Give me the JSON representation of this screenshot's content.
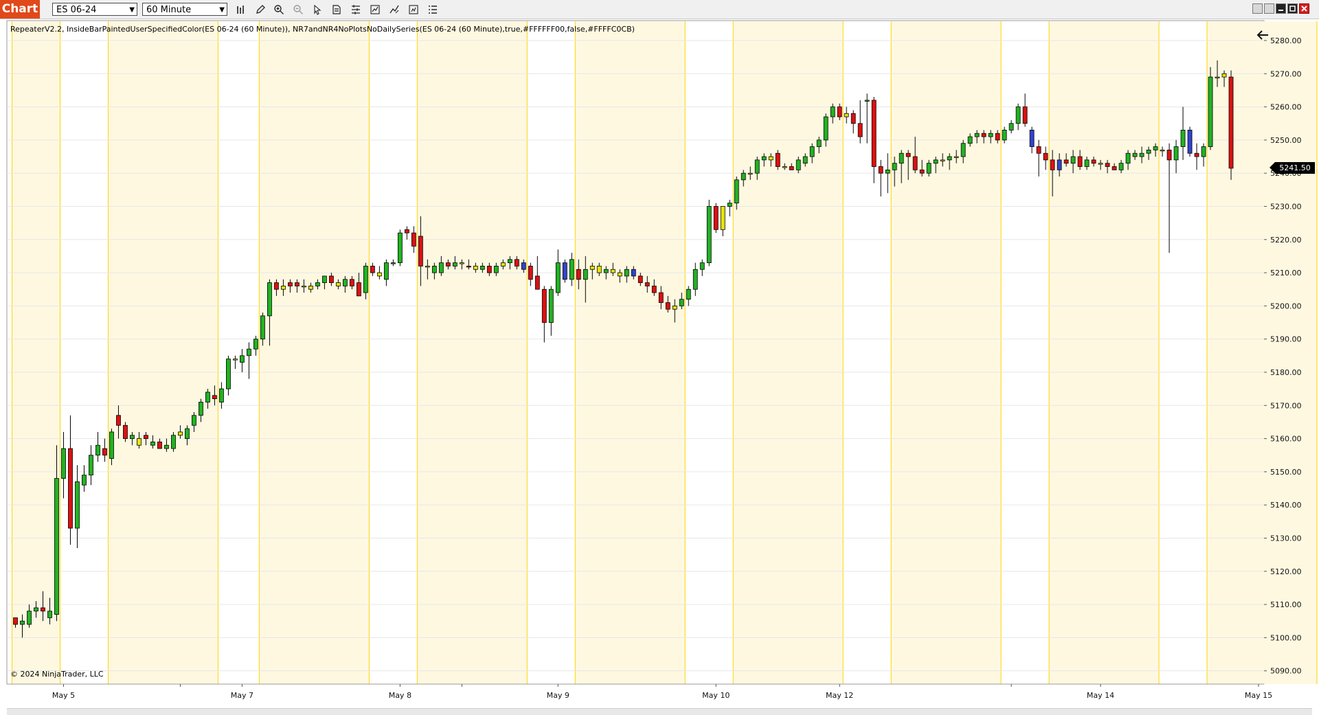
{
  "app": {
    "label": "Chart"
  },
  "toolbar": {
    "instrument": "ES 06-24",
    "interval": "60 Minute"
  },
  "legend_text": "RepeaterV2.2, InsideBarPaintedUserSpecifiedColor(ES 06-24 (60 Minute)), NR7andNR4NoPlotsNoDailySeries(ES 06-24 (60 Minute),true,#FFFFFF00,false,#FFFFC0CB)",
  "copyright": "© 2024 NinjaTrader, LLC",
  "last_price_label": "5241.50",
  "colors": {
    "up": "#22b322",
    "down": "#dd1111",
    "inside_bar": "#e6e600",
    "nr_bar": "#3344cc",
    "band": "#fef8e1",
    "band_line": "#ffd400"
  },
  "chart_data": {
    "type": "candlestick",
    "instrument": "ES 06-24",
    "interval": "60 Minute",
    "ylim": [
      5086,
      5286
    ],
    "y_ticks": [
      "5090.00",
      "5100.00",
      "5110.00",
      "5120.00",
      "5130.00",
      "5140.00",
      "5150.00",
      "5160.00",
      "5170.00",
      "5180.00",
      "5190.00",
      "5200.00",
      "5210.00",
      "5220.00",
      "5230.00",
      "5240.00",
      "5250.00",
      "5260.00",
      "5270.00",
      "5280.00"
    ],
    "x_labels": [
      "May 5",
      "May 7",
      "May 8",
      "May 9",
      "May 10",
      "May 12",
      "May 14",
      "May 15"
    ],
    "last_price": 5241.5,
    "session_bands": [
      [
        0,
        6
      ],
      [
        14,
        29
      ],
      [
        36,
        51
      ],
      [
        59,
        74
      ],
      [
        82,
        97
      ],
      [
        105,
        120
      ],
      [
        128,
        143
      ],
      [
        151,
        166
      ],
      [
        174,
        189
      ]
    ],
    "candles": [
      [
        5106,
        5106,
        5103,
        5104,
        "d"
      ],
      [
        5104,
        5107,
        5100,
        5105,
        "u"
      ],
      [
        5104,
        5110,
        5103,
        5108,
        "u"
      ],
      [
        5108,
        5111,
        5106,
        5109,
        "u"
      ],
      [
        5109,
        5114,
        5105,
        5108,
        "d"
      ],
      [
        5106,
        5112,
        5104,
        5108,
        "u"
      ],
      [
        5107,
        5158,
        5105,
        5148,
        "u"
      ],
      [
        5148,
        5162,
        5142,
        5157,
        "u"
      ],
      [
        5157,
        5167,
        5128,
        5133,
        "d"
      ],
      [
        5133,
        5152,
        5127,
        5147,
        "u"
      ],
      [
        5146,
        5152,
        5144,
        5149,
        "u"
      ],
      [
        5149,
        5158,
        5146,
        5155,
        "u"
      ],
      [
        5155,
        5162,
        5153,
        5158,
        "u"
      ],
      [
        5155,
        5160,
        5153,
        5157,
        "d"
      ],
      [
        5154,
        5163,
        5152,
        5162,
        "u"
      ],
      [
        5164,
        5170,
        5160,
        5167,
        "d"
      ],
      [
        5164,
        5165,
        5159,
        5160,
        "d"
      ],
      [
        5160,
        5162,
        5158,
        5161,
        "u"
      ],
      [
        5158,
        5162,
        5157,
        5160,
        "i"
      ],
      [
        5161,
        5162,
        5158,
        5160,
        "d"
      ],
      [
        5158,
        5161,
        5157,
        5159,
        "u"
      ],
      [
        5159,
        5160,
        5157,
        5157,
        "d"
      ],
      [
        5157,
        5160,
        5156,
        5158,
        "u"
      ],
      [
        5157,
        5162,
        5156,
        5161,
        "u"
      ],
      [
        5162,
        5164,
        5160,
        5161,
        "i"
      ],
      [
        5160,
        5164,
        5158,
        5163,
        "u"
      ],
      [
        5164,
        5168,
        5162,
        5167,
        "u"
      ],
      [
        5167,
        5172,
        5165,
        5171,
        "u"
      ],
      [
        5171,
        5175,
        5169,
        5174,
        "u"
      ],
      [
        5173,
        5176,
        5170,
        5172,
        "d"
      ],
      [
        5171,
        5177,
        5169,
        5175,
        "u"
      ],
      [
        5175,
        5185,
        5173,
        5184,
        "u"
      ],
      [
        5184,
        5185,
        5181,
        5184,
        "i"
      ],
      [
        5183,
        5187,
        5180,
        5185,
        "u"
      ],
      [
        5185,
        5189,
        5178,
        5187,
        "u"
      ],
      [
        5187,
        5191,
        5185,
        5190,
        "u"
      ],
      [
        5190,
        5198,
        5188,
        5197,
        "u"
      ],
      [
        5197,
        5208,
        5188,
        5207,
        "u"
      ],
      [
        5207,
        5208,
        5203,
        5205,
        "d"
      ],
      [
        5205,
        5208,
        5203,
        5206,
        "i"
      ],
      [
        5206,
        5208,
        5204,
        5207,
        "d"
      ],
      [
        5207,
        5208,
        5204,
        5206,
        "d"
      ],
      [
        5206,
        5208,
        5204,
        5206,
        "i"
      ],
      [
        5206,
        5207,
        5204,
        5205,
        "i"
      ],
      [
        5206,
        5208,
        5205,
        5207,
        "u"
      ],
      [
        5207,
        5209,
        5205,
        5209,
        "u"
      ],
      [
        5209,
        5210,
        5206,
        5207,
        "d"
      ],
      [
        5207,
        5208,
        5205,
        5206,
        "i"
      ],
      [
        5206,
        5209,
        5204,
        5208,
        "u"
      ],
      [
        5208,
        5209,
        5205,
        5206,
        "d"
      ],
      [
        5207,
        5210,
        5203,
        5203,
        "d"
      ],
      [
        5204,
        5213,
        5202,
        5212,
        "u"
      ],
      [
        5212,
        5213,
        5209,
        5210,
        "d"
      ],
      [
        5209,
        5212,
        5208,
        5210,
        "i"
      ],
      [
        5208,
        5214,
        5206,
        5213,
        "u"
      ],
      [
        5213,
        5214,
        5212,
        5213,
        "u"
      ],
      [
        5213,
        5223,
        5212,
        5222,
        "u"
      ],
      [
        5222,
        5224,
        5220,
        5223,
        "d"
      ],
      [
        5222,
        5224,
        5216,
        5218,
        "d"
      ],
      [
        5221,
        5227,
        5206,
        5212,
        "d"
      ],
      [
        5212,
        5214,
        5208,
        5212,
        "i"
      ],
      [
        5212,
        5213,
        5208,
        5210,
        "u"
      ],
      [
        5210,
        5215,
        5209,
        5213,
        "u"
      ],
      [
        5213,
        5214,
        5211,
        5212,
        "d"
      ],
      [
        5212,
        5215,
        5211,
        5213,
        "u"
      ],
      [
        5213,
        5214,
        5211,
        5213,
        "i"
      ],
      [
        5212,
        5214,
        5211,
        5212,
        "d"
      ],
      [
        5212,
        5213,
        5210,
        5211,
        "i"
      ],
      [
        5211,
        5213,
        5210,
        5212,
        "u"
      ],
      [
        5212,
        5213,
        5209,
        5210,
        "d"
      ],
      [
        5210,
        5213,
        5209,
        5212,
        "u"
      ],
      [
        5212,
        5214,
        5211,
        5213,
        "i"
      ],
      [
        5213,
        5215,
        5211,
        5214,
        "u"
      ],
      [
        5214,
        5215,
        5211,
        5212,
        "d"
      ],
      [
        5213,
        5214,
        5210,
        5211,
        "b"
      ],
      [
        5212,
        5213,
        5206,
        5208,
        "d"
      ],
      [
        5209,
        5215,
        5206,
        5205,
        "d"
      ],
      [
        5205,
        5206,
        5189,
        5195,
        "d"
      ],
      [
        5195,
        5206,
        5191,
        5205,
        "u"
      ],
      [
        5204,
        5217,
        5203,
        5213,
        "u"
      ],
      [
        5213,
        5214,
        5207,
        5208,
        "b"
      ],
      [
        5208,
        5216,
        5206,
        5214,
        "u"
      ],
      [
        5211,
        5214,
        5205,
        5208,
        "d"
      ],
      [
        5208,
        5215,
        5201,
        5211,
        "u"
      ],
      [
        5211,
        5213,
        5208,
        5212,
        "i"
      ],
      [
        5212,
        5213,
        5209,
        5210,
        "i"
      ],
      [
        5210,
        5212,
        5208,
        5211,
        "u"
      ],
      [
        5211,
        5213,
        5209,
        5210,
        "i"
      ],
      [
        5210,
        5211,
        5207,
        5209,
        "i"
      ],
      [
        5209,
        5212,
        5207,
        5211,
        "u"
      ],
      [
        5211,
        5212,
        5208,
        5209,
        "b"
      ],
      [
        5209,
        5210,
        5206,
        5207,
        "d"
      ],
      [
        5207,
        5209,
        5204,
        5206,
        "d"
      ],
      [
        5206,
        5208,
        5203,
        5204,
        "d"
      ],
      [
        5204,
        5206,
        5199,
        5201,
        "d"
      ],
      [
        5201,
        5203,
        5198,
        5199,
        "d"
      ],
      [
        5199,
        5202,
        5195,
        5200,
        "i"
      ],
      [
        5200,
        5204,
        5199,
        5202,
        "u"
      ],
      [
        5202,
        5206,
        5200,
        5205,
        "u"
      ],
      [
        5205,
        5213,
        5203,
        5211,
        "u"
      ],
      [
        5211,
        5214,
        5209,
        5213,
        "u"
      ],
      [
        5213,
        5232,
        5212,
        5230,
        "u"
      ],
      [
        5230,
        5231,
        5222,
        5223,
        "d"
      ],
      [
        5223,
        5230,
        5221,
        5230,
        "i"
      ],
      [
        5230,
        5232,
        5227,
        5231,
        "u"
      ],
      [
        5231,
        5239,
        5229,
        5238,
        "u"
      ],
      [
        5238,
        5241,
        5236,
        5240,
        "u"
      ],
      [
        5240,
        5242,
        5238,
        5240,
        "i"
      ],
      [
        5240,
        5245,
        5238,
        5244,
        "u"
      ],
      [
        5244,
        5246,
        5242,
        5245,
        "u"
      ],
      [
        5244,
        5246,
        5242,
        5245,
        "i"
      ],
      [
        5246,
        5247,
        5241,
        5242,
        "d"
      ],
      [
        5242,
        5243,
        5241,
        5242,
        "i"
      ],
      [
        5242,
        5243,
        5241,
        5241,
        "d"
      ],
      [
        5241,
        5245,
        5240,
        5244,
        "u"
      ],
      [
        5243,
        5246,
        5242,
        5245,
        "u"
      ],
      [
        5245,
        5249,
        5243,
        5248,
        "u"
      ],
      [
        5248,
        5251,
        5246,
        5250,
        "u"
      ],
      [
        5250,
        5258,
        5248,
        5257,
        "u"
      ],
      [
        5257,
        5261,
        5255,
        5260,
        "u"
      ],
      [
        5260,
        5261,
        5256,
        5257,
        "d"
      ],
      [
        5257,
        5260,
        5255,
        5258,
        "i"
      ],
      [
        5258,
        5259,
        5252,
        5255,
        "d"
      ],
      [
        5255,
        5262,
        5249,
        5251,
        "d"
      ],
      [
        5262,
        5264,
        5249,
        5262,
        "u"
      ],
      [
        5262,
        5263,
        5237,
        5242,
        "d"
      ],
      [
        5242,
        5244,
        5233,
        5240,
        "d"
      ],
      [
        5240,
        5246,
        5234,
        5241,
        "u"
      ],
      [
        5241,
        5245,
        5236,
        5243,
        "u"
      ],
      [
        5243,
        5247,
        5237,
        5246,
        "u"
      ],
      [
        5246,
        5247,
        5238,
        5245,
        "d"
      ],
      [
        5245,
        5251,
        5240,
        5241,
        "d"
      ],
      [
        5241,
        5244,
        5239,
        5240,
        "d"
      ],
      [
        5240,
        5244,
        5239,
        5243,
        "u"
      ],
      [
        5243,
        5245,
        5240,
        5244,
        "u"
      ],
      [
        5244,
        5246,
        5242,
        5244,
        "i"
      ],
      [
        5244,
        5246,
        5241,
        5245,
        "u"
      ],
      [
        5245,
        5247,
        5243,
        5245,
        "i"
      ],
      [
        5245,
        5250,
        5243,
        5249,
        "u"
      ],
      [
        5249,
        5252,
        5248,
        5251,
        "u"
      ],
      [
        5251,
        5253,
        5249,
        5252,
        "u"
      ],
      [
        5252,
        5253,
        5249,
        5251,
        "d"
      ],
      [
        5251,
        5253,
        5249,
        5252,
        "u"
      ],
      [
        5252,
        5253,
        5249,
        5250,
        "d"
      ],
      [
        5250,
        5254,
        5249,
        5253,
        "u"
      ],
      [
        5253,
        5256,
        5252,
        5255,
        "u"
      ],
      [
        5255,
        5261,
        5253,
        5260,
        "u"
      ],
      [
        5260,
        5264,
        5254,
        5255,
        "d"
      ],
      [
        5253,
        5254,
        5246,
        5248,
        "b"
      ],
      [
        5248,
        5250,
        5239,
        5246,
        "d"
      ],
      [
        5246,
        5248,
        5241,
        5244,
        "d"
      ],
      [
        5244,
        5247,
        5233,
        5241,
        "d"
      ],
      [
        5241,
        5246,
        5239,
        5244,
        "b"
      ],
      [
        5244,
        5246,
        5242,
        5243,
        "d"
      ],
      [
        5243,
        5247,
        5240,
        5245,
        "u"
      ],
      [
        5245,
        5247,
        5241,
        5242,
        "d"
      ],
      [
        5242,
        5245,
        5241,
        5244,
        "u"
      ],
      [
        5244,
        5245,
        5242,
        5243,
        "d"
      ],
      [
        5243,
        5244,
        5241,
        5243,
        "i"
      ],
      [
        5243,
        5244,
        5240,
        5242,
        "d"
      ],
      [
        5242,
        5243,
        5241,
        5241,
        "d"
      ],
      [
        5241,
        5244,
        5240,
        5243,
        "u"
      ],
      [
        5243,
        5247,
        5241,
        5246,
        "u"
      ],
      [
        5246,
        5247,
        5244,
        5245,
        "u"
      ],
      [
        5245,
        5248,
        5243,
        5246,
        "u"
      ],
      [
        5246,
        5248,
        5244,
        5247,
        "u"
      ],
      [
        5247,
        5249,
        5245,
        5248,
        "u"
      ],
      [
        5247,
        5248,
        5245,
        5247,
        "i"
      ],
      [
        5247,
        5249,
        5216,
        5244,
        "d"
      ],
      [
        5244,
        5250,
        5240,
        5248,
        "u"
      ],
      [
        5248,
        5260,
        5244,
        5253,
        "u"
      ],
      [
        5253,
        5254,
        5245,
        5246,
        "b"
      ],
      [
        5246,
        5249,
        5241,
        5245,
        "d"
      ],
      [
        5245,
        5249,
        5242,
        5248,
        "u"
      ],
      [
        5248,
        5272,
        5247,
        5269,
        "u"
      ],
      [
        5269,
        5274,
        5266,
        5269,
        "i"
      ],
      [
        5269,
        5271,
        5266,
        5270,
        "i"
      ],
      [
        5269,
        5271,
        5238,
        5241.5,
        "d"
      ]
    ]
  }
}
